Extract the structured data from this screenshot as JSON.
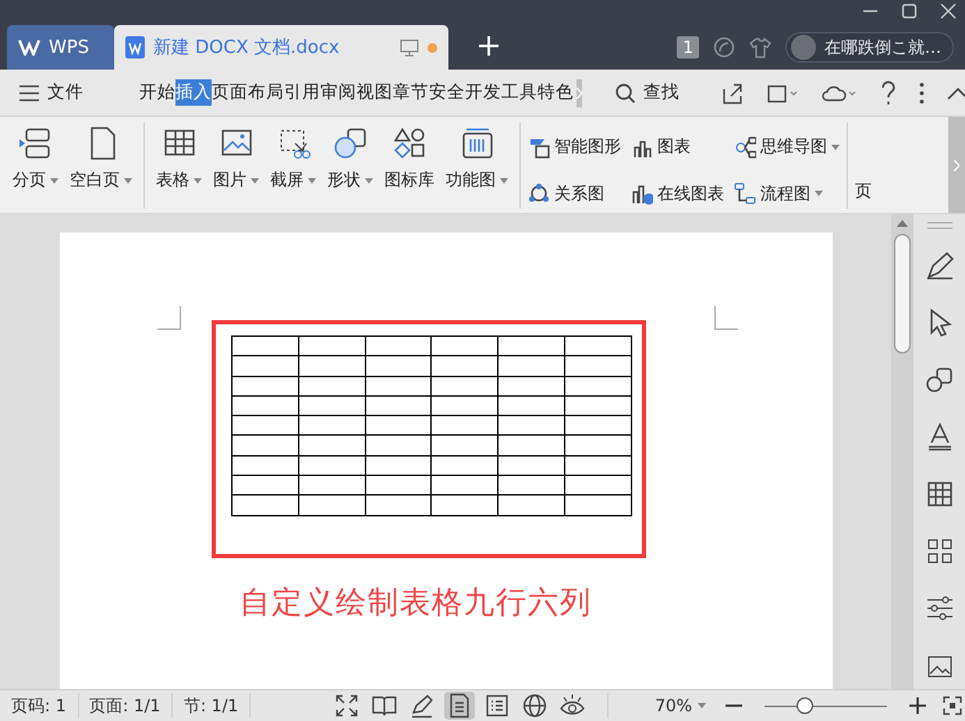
{
  "title_bar": {
    "tabs": [
      {
        "kind": "home",
        "label": "WPS",
        "selected": false,
        "unsaved": false
      },
      {
        "kind": "document",
        "label": "新建 DOCX 文档.docx",
        "selected": true,
        "unsaved": true
      }
    ],
    "badge": "1",
    "user": "在哪跌倒こ就…"
  },
  "menu_bar": {
    "file": "文件",
    "tabs": [
      {
        "label": "开始",
        "selected": false
      },
      {
        "label": "插入",
        "selected": true
      },
      {
        "label": "页面布局",
        "selected": false
      },
      {
        "label": "引用",
        "selected": false
      },
      {
        "label": "审阅",
        "selected": false
      },
      {
        "label": "视图",
        "selected": false
      },
      {
        "label": "章节",
        "selected": false
      },
      {
        "label": "安全",
        "selected": false
      },
      {
        "label": "开发工具",
        "selected": false
      },
      {
        "label": "特色",
        "selected": false
      }
    ],
    "search": "查找"
  },
  "ribbon": {
    "groups": [
      {
        "kind": "large",
        "items": [
          {
            "kind": "page-break",
            "label": "分页",
            "dropdown": true
          },
          {
            "kind": "blank-page",
            "label": "空白页",
            "dropdown": true
          }
        ]
      },
      {
        "kind": "large",
        "items": [
          {
            "kind": "table",
            "label": "表格",
            "dropdown": true
          },
          {
            "kind": "picture",
            "label": "图片",
            "dropdown": true
          },
          {
            "kind": "screenshot",
            "label": "截屏",
            "dropdown": true
          },
          {
            "kind": "shape",
            "label": "形状",
            "dropdown": true
          },
          {
            "kind": "icon-library",
            "label": "图标库",
            "dropdown": false
          },
          {
            "kind": "function-chart",
            "label": "功能图",
            "dropdown": true
          }
        ]
      },
      {
        "kind": "small",
        "items": [
          {
            "kind": "smart-art",
            "label": "智能图形",
            "dropdown": false
          },
          {
            "kind": "chart",
            "label": "图表",
            "dropdown": false
          },
          {
            "kind": "mind-map",
            "label": "思维导图",
            "dropdown": true
          },
          {
            "kind": "relation",
            "label": "关系图",
            "dropdown": false
          },
          {
            "kind": "online-chart",
            "label": "在线图表",
            "dropdown": false
          },
          {
            "kind": "flowchart",
            "label": "流程图",
            "dropdown": true
          }
        ]
      },
      {
        "kind": "cut",
        "items": [
          {
            "kind": "text",
            "label": "页",
            "dropdown": false
          }
        ]
      }
    ]
  },
  "document": {
    "table": {
      "rows": [
        {
          "cells": [
            {
              "kind": "empty"
            },
            {
              "kind": "empty"
            },
            {
              "kind": "empty"
            },
            {
              "kind": "empty"
            },
            {
              "kind": "empty"
            },
            {
              "kind": "empty"
            }
          ]
        },
        {
          "cells": [
            {
              "kind": "empty"
            },
            {
              "kind": "empty"
            },
            {
              "kind": "empty"
            },
            {
              "kind": "empty"
            },
            {
              "kind": "empty"
            },
            {
              "kind": "empty"
            }
          ]
        },
        {
          "cells": [
            {
              "kind": "empty"
            },
            {
              "kind": "empty"
            },
            {
              "kind": "empty"
            },
            {
              "kind": "empty"
            },
            {
              "kind": "empty"
            },
            {
              "kind": "empty"
            }
          ]
        },
        {
          "cells": [
            {
              "kind": "empty"
            },
            {
              "kind": "empty"
            },
            {
              "kind": "empty"
            },
            {
              "kind": "empty"
            },
            {
              "kind": "empty"
            },
            {
              "kind": "empty"
            }
          ]
        },
        {
          "cells": [
            {
              "kind": "empty"
            },
            {
              "kind": "empty"
            },
            {
              "kind": "empty"
            },
            {
              "kind": "empty"
            },
            {
              "kind": "empty"
            },
            {
              "kind": "empty"
            }
          ]
        },
        {
          "cells": [
            {
              "kind": "empty"
            },
            {
              "kind": "empty"
            },
            {
              "kind": "empty"
            },
            {
              "kind": "empty"
            },
            {
              "kind": "empty"
            },
            {
              "kind": "empty"
            }
          ]
        },
        {
          "cells": [
            {
              "kind": "empty"
            },
            {
              "kind": "empty"
            },
            {
              "kind": "empty"
            },
            {
              "kind": "empty"
            },
            {
              "kind": "empty"
            },
            {
              "kind": "empty"
            }
          ]
        },
        {
          "cells": [
            {
              "kind": "empty"
            },
            {
              "kind": "empty"
            },
            {
              "kind": "empty"
            },
            {
              "kind": "empty"
            },
            {
              "kind": "empty"
            },
            {
              "kind": "empty"
            }
          ]
        },
        {
          "cells": [
            {
              "kind": "empty"
            },
            {
              "kind": "empty"
            },
            {
              "kind": "empty"
            },
            {
              "kind": "empty"
            },
            {
              "kind": "empty"
            },
            {
              "kind": "empty"
            }
          ]
        }
      ]
    },
    "annotation": "自定义绘制表格九行六列"
  },
  "side_panel": {
    "tools": [
      {
        "kind": "pen"
      },
      {
        "kind": "cursor"
      },
      {
        "kind": "shapes"
      },
      {
        "kind": "text-style"
      },
      {
        "kind": "table"
      },
      {
        "kind": "grid"
      },
      {
        "kind": "sliders"
      },
      {
        "kind": "picture"
      }
    ]
  },
  "status_bar": {
    "page_number": "页码: 1",
    "pages": "页面: 1/1",
    "section": "节: 1/1",
    "views": [
      {
        "kind": "fullscreen",
        "selected": false
      },
      {
        "kind": "reading",
        "selected": false
      },
      {
        "kind": "pen",
        "selected": false
      },
      {
        "kind": "page",
        "selected": true
      },
      {
        "kind": "outline",
        "selected": false
      },
      {
        "kind": "web",
        "selected": false
      },
      {
        "kind": "eye",
        "selected": false
      }
    ],
    "zoom": "70%",
    "zoom_slider": {
      "level": 0.33
    }
  }
}
